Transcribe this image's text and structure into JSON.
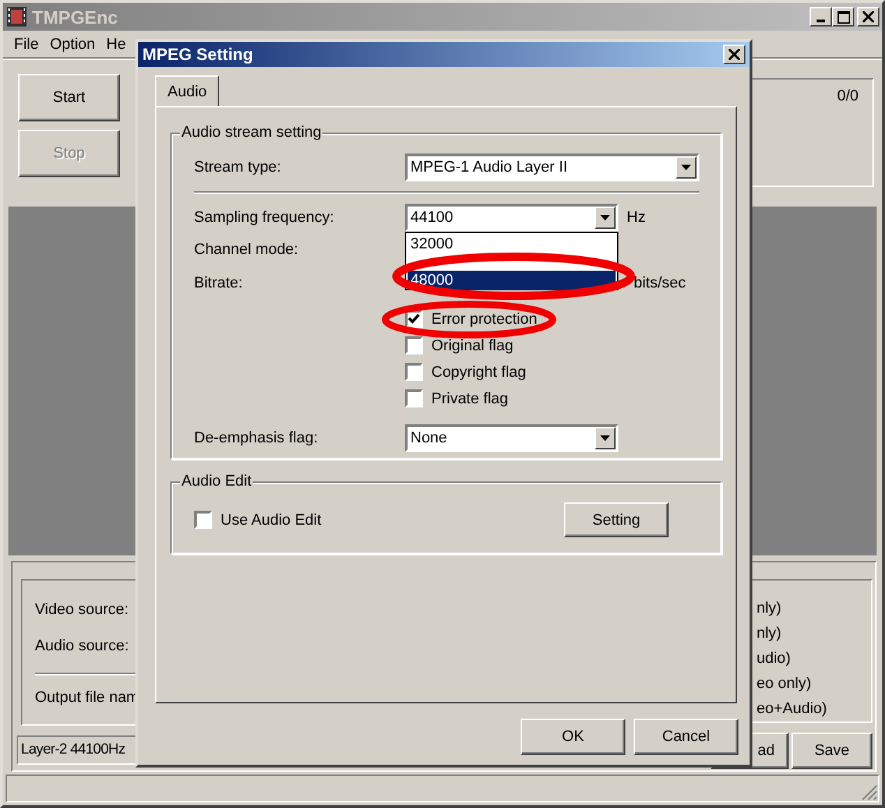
{
  "main_window": {
    "title": "TMPGEnc",
    "menu": [
      "File",
      "Option",
      "He"
    ],
    "buttons": [
      {
        "label": "Start",
        "disabled": false
      },
      {
        "label": "Stop",
        "disabled": true
      }
    ],
    "counter": "0/0",
    "source_labels": [
      "Video source:",
      "Audio source:",
      "Output file nam"
    ],
    "right_options": [
      "nly)",
      "nly)",
      "udio)",
      "eo only)",
      "eo+Audio)"
    ],
    "format_field": "Layer-2 44100Hz",
    "bottom_buttons": [
      "ad",
      "Save"
    ]
  },
  "dialog": {
    "title": "MPEG Setting",
    "tabs": [
      {
        "label": "Audio",
        "selected": true
      }
    ],
    "stream_group": {
      "title": "Audio stream setting",
      "stream_type": {
        "label": "Stream type:",
        "value": "MPEG-1 Audio Layer II"
      },
      "sampling": {
        "label": "Sampling frequency:",
        "value": "44100",
        "unit": "Hz",
        "options": [
          {
            "label": "32000",
            "selected": false
          },
          {
            "label": "48000",
            "selected": true
          }
        ]
      },
      "channel_mode": {
        "label": "Channel mode:"
      },
      "bitrate": {
        "label": "Bitrate:",
        "unit": "bits/sec"
      },
      "flags": [
        {
          "label": "Error protection",
          "checked": true
        },
        {
          "label": "Original flag",
          "checked": false
        },
        {
          "label": "Copyright flag",
          "checked": false
        },
        {
          "label": "Private flag",
          "checked": false
        }
      ],
      "deemphasis": {
        "label": "De-emphasis flag:",
        "value": "None"
      }
    },
    "edit_group": {
      "title": "Audio Edit",
      "use_edit": {
        "label": "Use Audio Edit",
        "checked": false
      },
      "button": "Setting"
    },
    "buttons": [
      "OK",
      "Cancel"
    ]
  }
}
